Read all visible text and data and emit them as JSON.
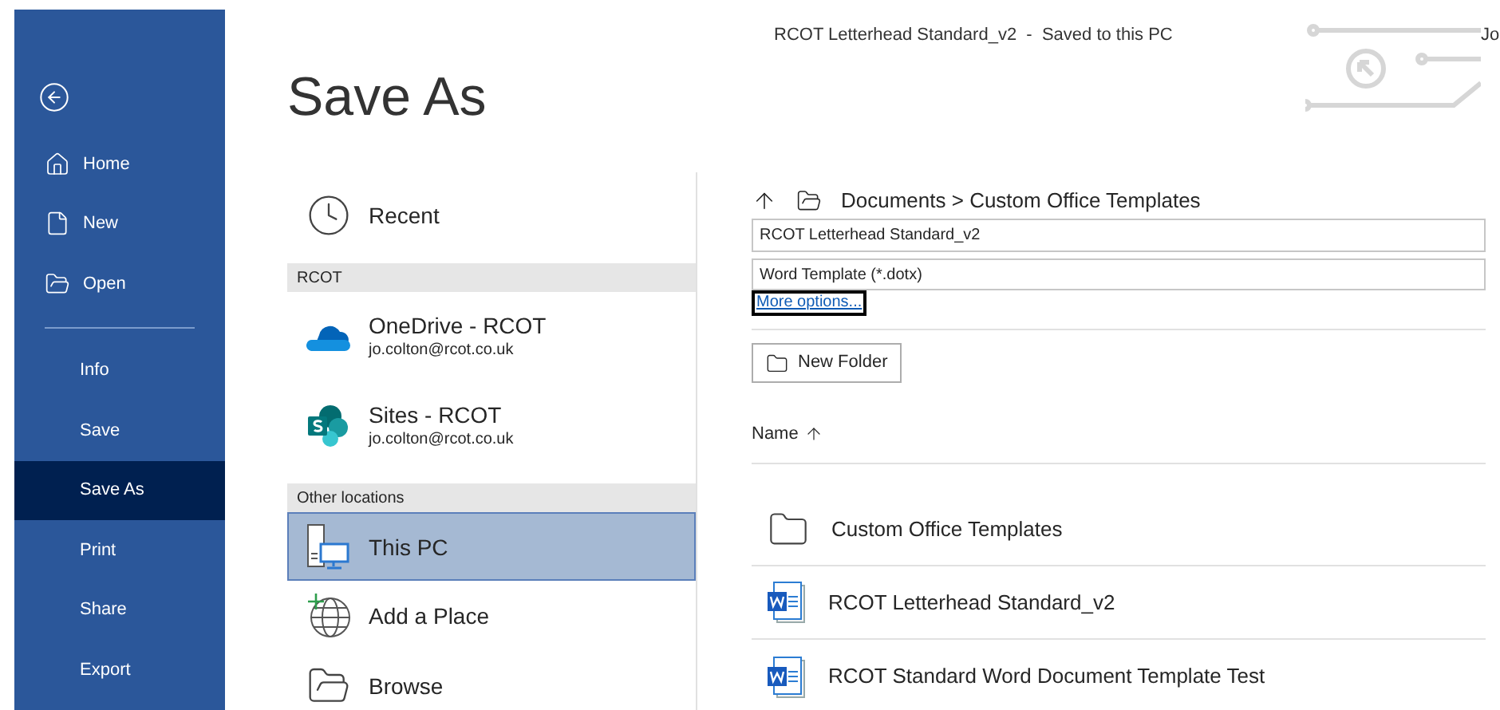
{
  "window": {
    "title": "RCOT Letterhead Standard_v2  -  Saved to this PC",
    "user": "Jo"
  },
  "sidebar": {
    "top_items": [
      {
        "label": "Home",
        "kind": "home",
        "selected": false
      },
      {
        "label": "New",
        "kind": "new",
        "selected": false
      },
      {
        "label": "Open",
        "kind": "open",
        "selected": false
      }
    ],
    "bottom_items": [
      {
        "label": "Info",
        "selected": false
      },
      {
        "label": "Save",
        "selected": false
      },
      {
        "label": "Save As",
        "selected": true
      },
      {
        "label": "Print",
        "selected": false
      },
      {
        "label": "Share",
        "selected": false
      },
      {
        "label": "Export",
        "selected": false
      }
    ]
  },
  "heading": "Save As",
  "locations": [
    {
      "kind": "recent",
      "label": "Recent",
      "selected": false
    },
    {
      "kind": "section",
      "label": "RCOT"
    },
    {
      "kind": "onedrive",
      "label": "OneDrive - RCOT",
      "sublabel": "jo.colton@rcot.co.uk",
      "selected": false
    },
    {
      "kind": "sharepoint",
      "label": "Sites - RCOT",
      "sublabel": "jo.colton@rcot.co.uk",
      "selected": false
    },
    {
      "kind": "section",
      "label": "Other locations"
    },
    {
      "kind": "pc",
      "label": "This PC",
      "selected": true
    },
    {
      "kind": "add-place",
      "label": "Add a Place",
      "selected": false
    },
    {
      "kind": "browse",
      "label": "Browse",
      "selected": false
    }
  ],
  "save_pane": {
    "path": "Documents > Custom Office Templates",
    "file_name": "RCOT Letterhead Standard_v2",
    "file_type": "Word Template (*.dotx)",
    "more_options": "More options...",
    "new_folder": "New Folder",
    "sort_column": "Name",
    "files": [
      {
        "kind": "folder",
        "name": "Custom Office Templates"
      },
      {
        "kind": "word",
        "name": "RCOT Letterhead Standard_v2"
      },
      {
        "kind": "word",
        "name": "RCOT Standard Word Document Template Test"
      }
    ]
  }
}
